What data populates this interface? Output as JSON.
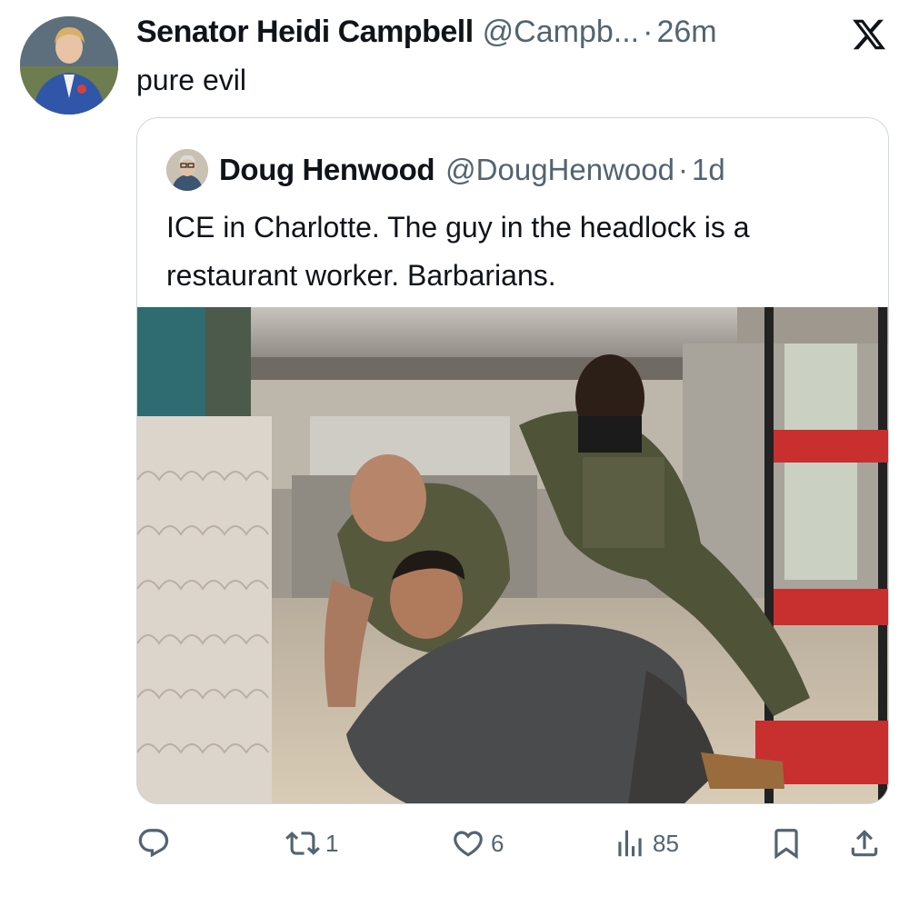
{
  "tweet": {
    "author_name": "Senator Heidi Campbell",
    "author_handle": "@Campb...",
    "separator": "·",
    "time": "26m",
    "text": "pure evil"
  },
  "quoted_tweet": {
    "author_name": "Doug Henwood",
    "author_handle": "@DougHenwood",
    "separator": "·",
    "time": "1d",
    "text": "ICE in Charlotte. The guy in the headlock is a restaurant worker. Barbarians."
  },
  "actions": {
    "reply_count": "",
    "retweet_count": "1",
    "like_count": "6",
    "views_count": "85"
  },
  "icons": {
    "brand": "x-logo-icon",
    "reply": "reply-icon",
    "retweet": "retweet-icon",
    "like": "heart-icon",
    "views": "views-chart-icon",
    "bookmark": "bookmark-icon",
    "share": "share-icon"
  },
  "colors": {
    "text": "#0f1419",
    "muted": "#536471",
    "border": "#cfd9de"
  }
}
